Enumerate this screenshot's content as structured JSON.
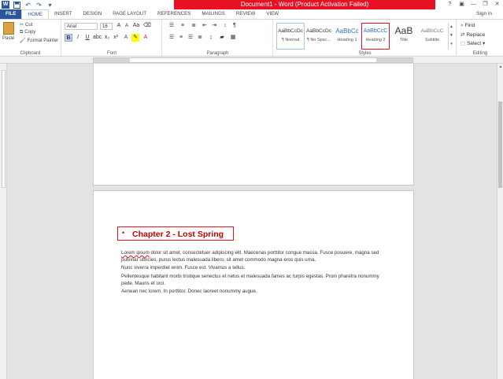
{
  "window": {
    "title": "Document1 - Word (Product Activation Failed)",
    "controls": [
      "?",
      "▣",
      "—",
      "❐",
      "✕"
    ]
  },
  "qat": {
    "icons": [
      "word-logo-icon",
      "save-icon",
      "undo-icon",
      "redo-icon",
      "customize-icon"
    ],
    "logo_letter": "W"
  },
  "tabs": [
    "FILE",
    "HOME",
    "INSERT",
    "DESIGN",
    "PAGE LAYOUT",
    "REFERENCES",
    "MAILINGS",
    "REVIEW",
    "VIEW"
  ],
  "active_tab": "HOME",
  "signin": "Sign in",
  "clipboard": {
    "paste": "Paste",
    "cut": "Cut",
    "copy": "Copy",
    "format_painter": "Format Painter",
    "label": "Clipboard"
  },
  "font": {
    "name": "Arial",
    "size": "16",
    "label": "Font",
    "bold_label": "B",
    "italic_label": "I",
    "underline_label": "U"
  },
  "paragraph": {
    "label": "Paragraph"
  },
  "styles": {
    "label": "Styles",
    "items": [
      {
        "sample": "AaBbCcDc",
        "name": "¶ Normal"
      },
      {
        "sample": "AaBbCcDc",
        "name": "¶ No Spac..."
      },
      {
        "sample": "AaBbCc",
        "name": "Heading 1"
      },
      {
        "sample": "AaBbCcC",
        "name": "Heading 2"
      },
      {
        "sample": "AaB",
        "name": "Title"
      },
      {
        "sample": "AaBbCcC",
        "name": "Subtitle"
      }
    ]
  },
  "editing": {
    "find": "Find",
    "replace": "Replace",
    "select": "Select",
    "label": "Editing"
  },
  "document": {
    "heading": "Chapter 2 - Lost Spring",
    "paragraphs": [
      {
        "first_word": "Lorem ipsum",
        "rest": " dolor sit amet, consectetuer adipiscing elit. Maecenas porttitor congue massa. Fusce posuere, magna sed pulvinar ultricies, purus lectus malesuada libero, sit amet commodo magna eros quis urna."
      },
      {
        "text": "Nunc viverra imperdiet enim. Fusce est. Vivamus a tellus."
      },
      {
        "text": "Pellentesque habitant morbi tristique senectus et netus et malesuada fames ac turpis egestas. Proin pharetra nonummy pede. Mauris et orci."
      },
      {
        "text": "Aenean nec lorem. In porttitor. Donec laoreet nonummy augue."
      }
    ]
  }
}
